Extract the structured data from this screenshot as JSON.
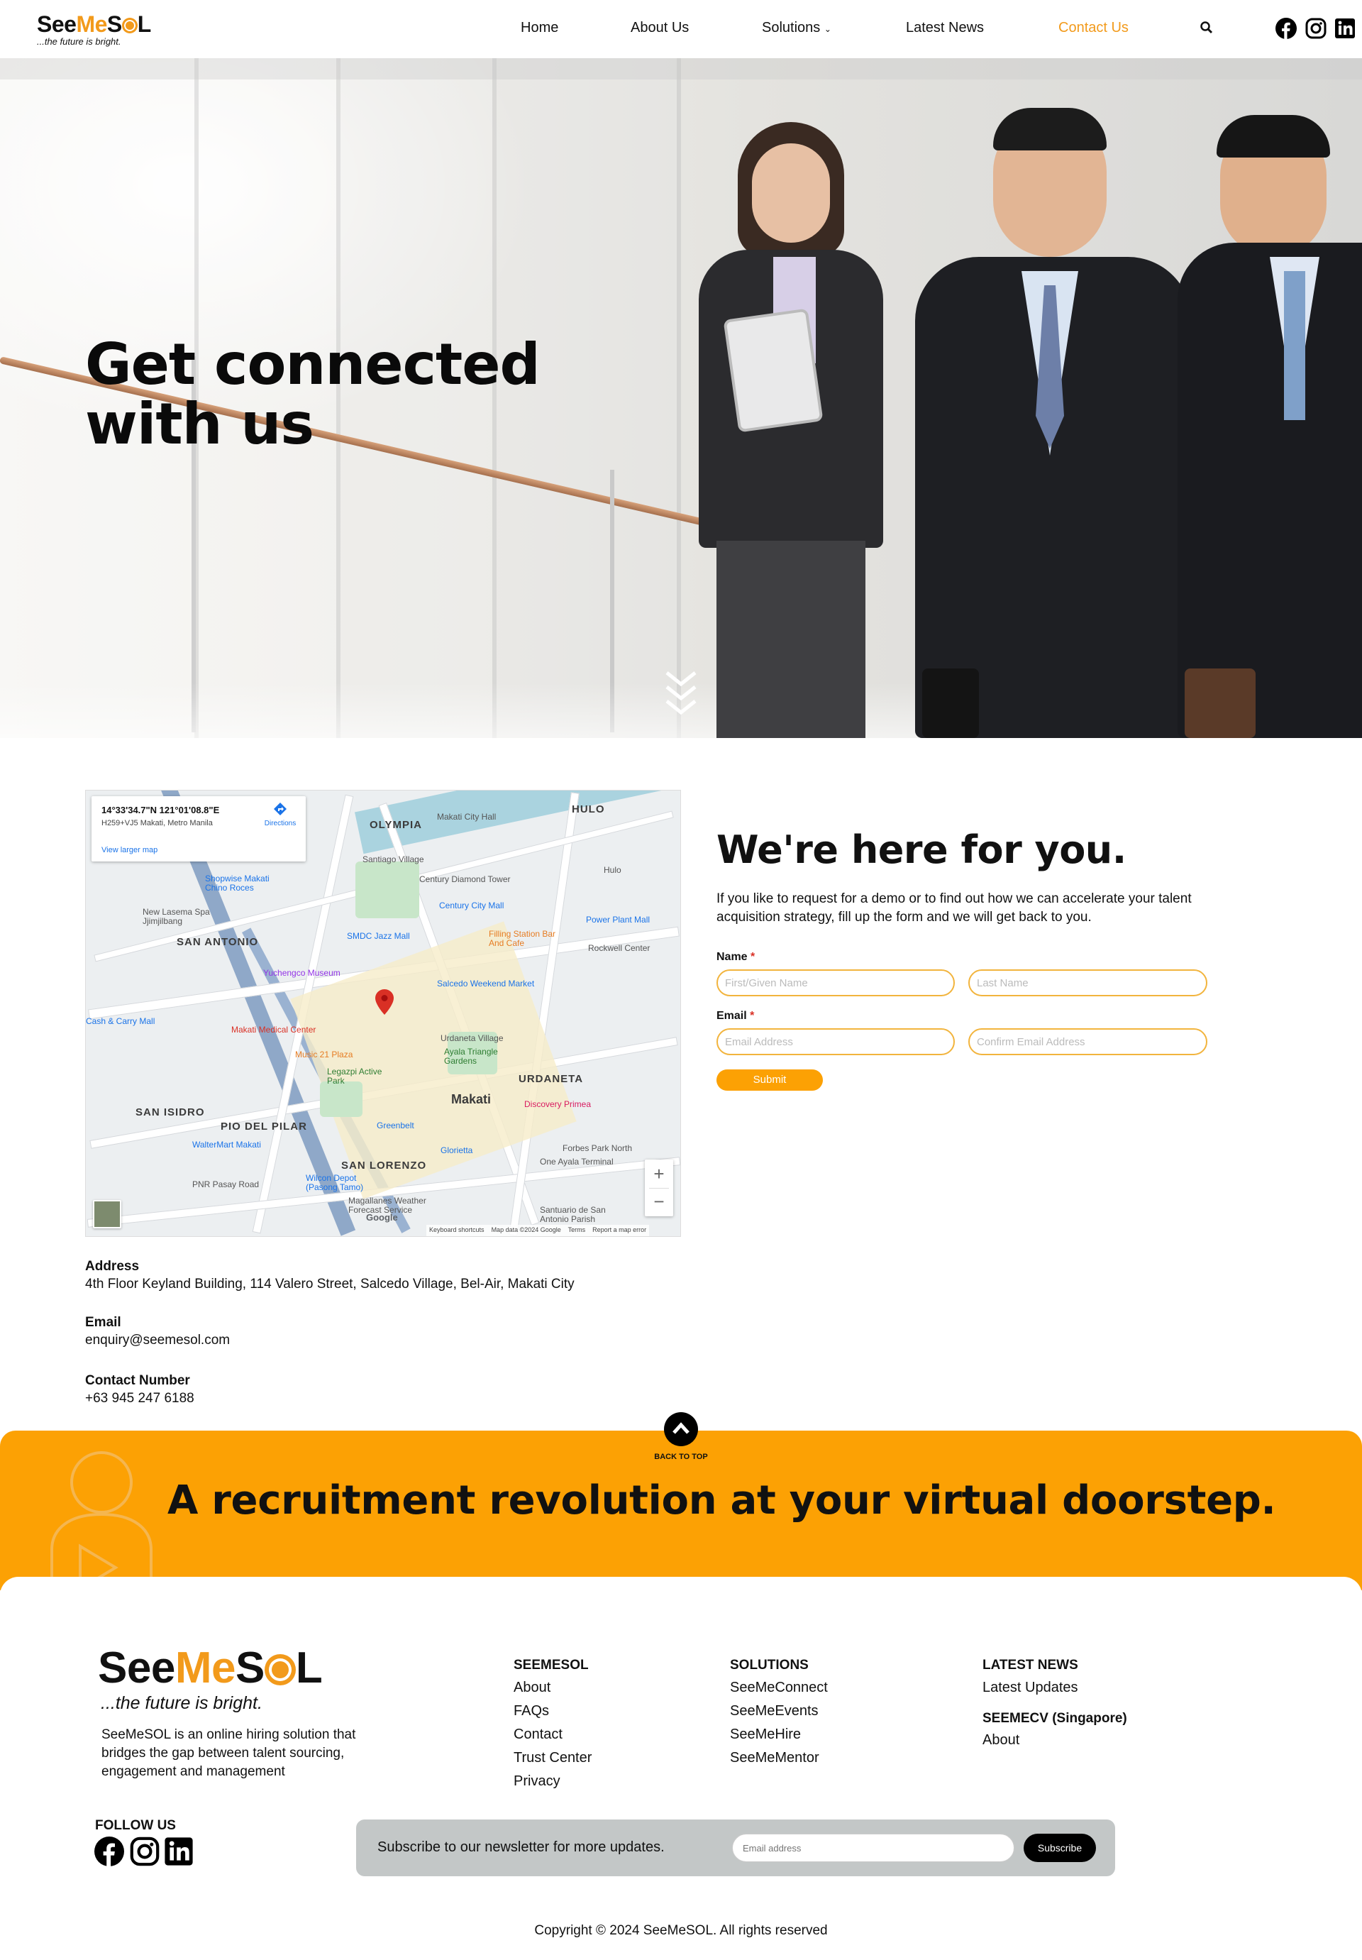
{
  "brand": {
    "logo_see": "See",
    "logo_me": "Me",
    "logo_s": "S",
    "logo_l": "L",
    "tagline": "...the future is bright."
  },
  "nav": {
    "home": "Home",
    "about": "About Us",
    "solutions": "Solutions",
    "news": "Latest News",
    "contact": "Contact Us"
  },
  "hero": {
    "title_line1": "Get connected",
    "title_line2": "with us"
  },
  "map": {
    "coords": "14°33'34.7\"N 121°01'08.8\"E",
    "plus_code": "H259+VJ5 Makati, Metro Manila",
    "directions": "Directions",
    "larger_map": "View larger map",
    "districts": [
      "OLYMPIA",
      "HULO",
      "SAN ANTONIO",
      "URDANETA",
      "SAN ISIDRO",
      "PIO DEL PILAR",
      "SAN LORENZO",
      "Makati"
    ],
    "pois": [
      "Makati City Hall",
      "Santiago Village",
      "Century Diamond Tower",
      "Hulo",
      "Shopwise Makati Chino Roces",
      "Century City Mall",
      "New Lasema Spa Jjimjilbang",
      "SMDC Jazz Mall",
      "Filling Station Bar And Cafe",
      "Power Plant Mall",
      "Rockwell Center",
      "Yuchengco Museum",
      "Salcedo Weekend Market",
      "Makati Medical Center",
      "Urdaneta Village",
      "Ayala Triangle Gardens",
      "Music 21 Plaza",
      "Legazpi Active Park",
      "Discovery Primea",
      "Greenbelt",
      "WalterMart Makati",
      "Glorietta",
      "Forbes Park North",
      "One Ayala Terminal",
      "Wilcon Depot (Pasong Tamo)",
      "Magallanes Weather Forecast Service",
      "Santuario de San Antonio Parish",
      "PNR Pasay Road",
      "Cash & Carry Mall"
    ],
    "footer": [
      "Keyboard shortcuts",
      "Map data ©2024 Google",
      "Terms",
      "Report a map error"
    ],
    "google": "Google"
  },
  "contact": {
    "heading": "We're here for you.",
    "intro": "If you like to request for a demo or to find out how we can accelerate your talent acquisition strategy, fill up the form and we will get back to you.",
    "name_label": "Name",
    "email_label": "Email",
    "required": "*",
    "first_placeholder": "First/Given Name",
    "last_placeholder": "Last Name",
    "email_placeholder": "Email Address",
    "confirm_placeholder": "Confirm Email Address",
    "submit": "Submit"
  },
  "info": {
    "address_label": "Address",
    "address": "4th Floor Keyland Building, 114 Valero Street, Salcedo Village, Bel-Air, Makati City",
    "email_label": "Email",
    "email": "enquiry@seemesol.com",
    "phone_label": "Contact Number",
    "phone": "+63 945 247 6188"
  },
  "back_to_top": "BACK TO TOP",
  "banner": {
    "text": "A recruitment revolution at your virtual doorstep."
  },
  "footer": {
    "description": "SeeMeSOL is an online hiring solution that bridges the gap between talent sourcing, engagement and management",
    "col1": {
      "title": "SEEMESOL",
      "links": [
        "About",
        "FAQs",
        "Contact",
        "Trust Center",
        "Privacy"
      ]
    },
    "col2": {
      "title": "SOLUTIONS",
      "links": [
        "SeeMeConnect",
        "SeeMeEvents",
        "SeeMeHire",
        "SeeMeMentor"
      ]
    },
    "col3": {
      "title": "LATEST NEWS",
      "links": [
        "Latest Updates"
      ],
      "title2": "SEEMECV (Singapore)",
      "links2": [
        "About"
      ]
    },
    "follow": "FOLLOW US",
    "newsletter_text": "Subscribe to our newsletter for more updates.",
    "newsletter_placeholder": "Email address",
    "subscribe": "Subscribe",
    "copyright": "Copyright © 2024 SeeMeSOL. All rights reserved"
  },
  "colors": {
    "accent": "#fca104",
    "nav_active": "#f29a1b",
    "pin": "#d93025"
  }
}
